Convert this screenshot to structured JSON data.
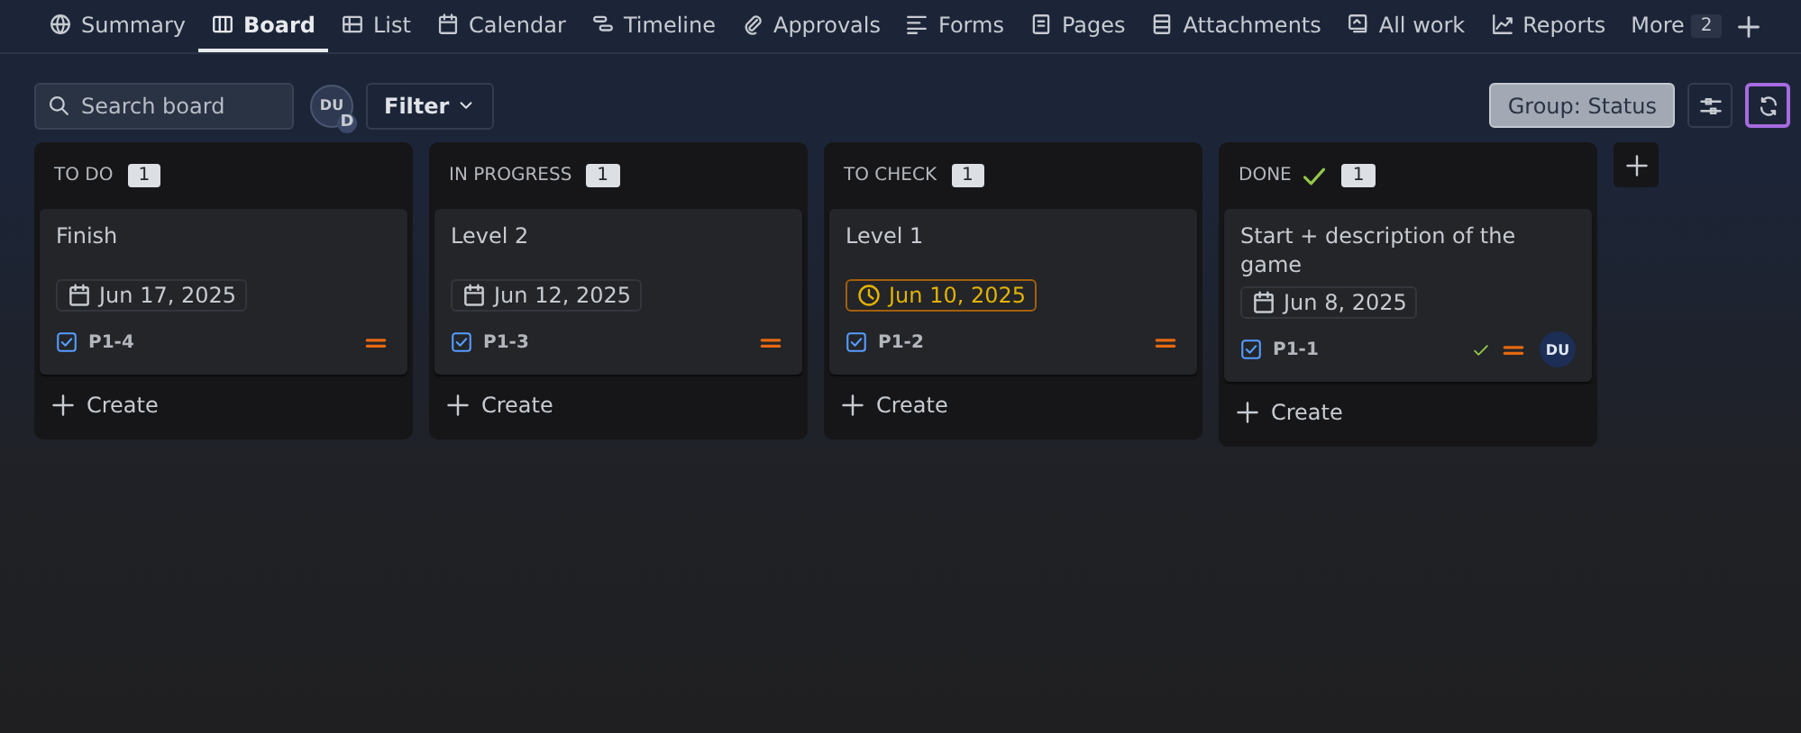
{
  "tabs": [
    {
      "label": "Summary",
      "selected": false
    },
    {
      "label": "Board",
      "selected": true
    },
    {
      "label": "List",
      "selected": false
    },
    {
      "label": "Calendar",
      "selected": false
    },
    {
      "label": "Timeline",
      "selected": false
    },
    {
      "label": "Approvals",
      "selected": false
    },
    {
      "label": "Forms",
      "selected": false
    },
    {
      "label": "Pages",
      "selected": false
    },
    {
      "label": "Attachments",
      "selected": false
    },
    {
      "label": "All work",
      "selected": false
    },
    {
      "label": "Reports",
      "selected": false
    }
  ],
  "more": {
    "label": "More",
    "count": "2"
  },
  "toolbar": {
    "search": {
      "placeholder": "Search board"
    },
    "avatar": {
      "initials": "DU",
      "badge": "D"
    },
    "filter": "Filter",
    "group": {
      "label": "Group: Status",
      "active": true
    }
  },
  "columns": [
    {
      "name": "TO DO",
      "count": "1",
      "done": false,
      "cards": [
        {
          "title": "Finish",
          "date": "Jun 17, 2025",
          "due_soon": false,
          "key": "P1-4",
          "resolved": false
        }
      ],
      "create": "Create"
    },
    {
      "name": "IN PROGRESS",
      "count": "1",
      "done": false,
      "cards": [
        {
          "title": "Level 2",
          "date": "Jun 12, 2025",
          "due_soon": false,
          "key": "P1-3",
          "resolved": false
        }
      ],
      "create": "Create"
    },
    {
      "name": "TO CHECK",
      "count": "1",
      "done": false,
      "cards": [
        {
          "title": "Level 1",
          "date": "Jun 10, 2025",
          "due_soon": true,
          "key": "P1-2",
          "resolved": false
        }
      ],
      "create": "Create"
    },
    {
      "name": "DONE",
      "count": "1",
      "done": true,
      "cards": [
        {
          "title": "Start + description of the game",
          "date": "Jun 8, 2025",
          "due_soon": false,
          "key": "P1-1",
          "resolved": true,
          "assignee": "DU"
        }
      ],
      "create": "Create"
    }
  ]
}
